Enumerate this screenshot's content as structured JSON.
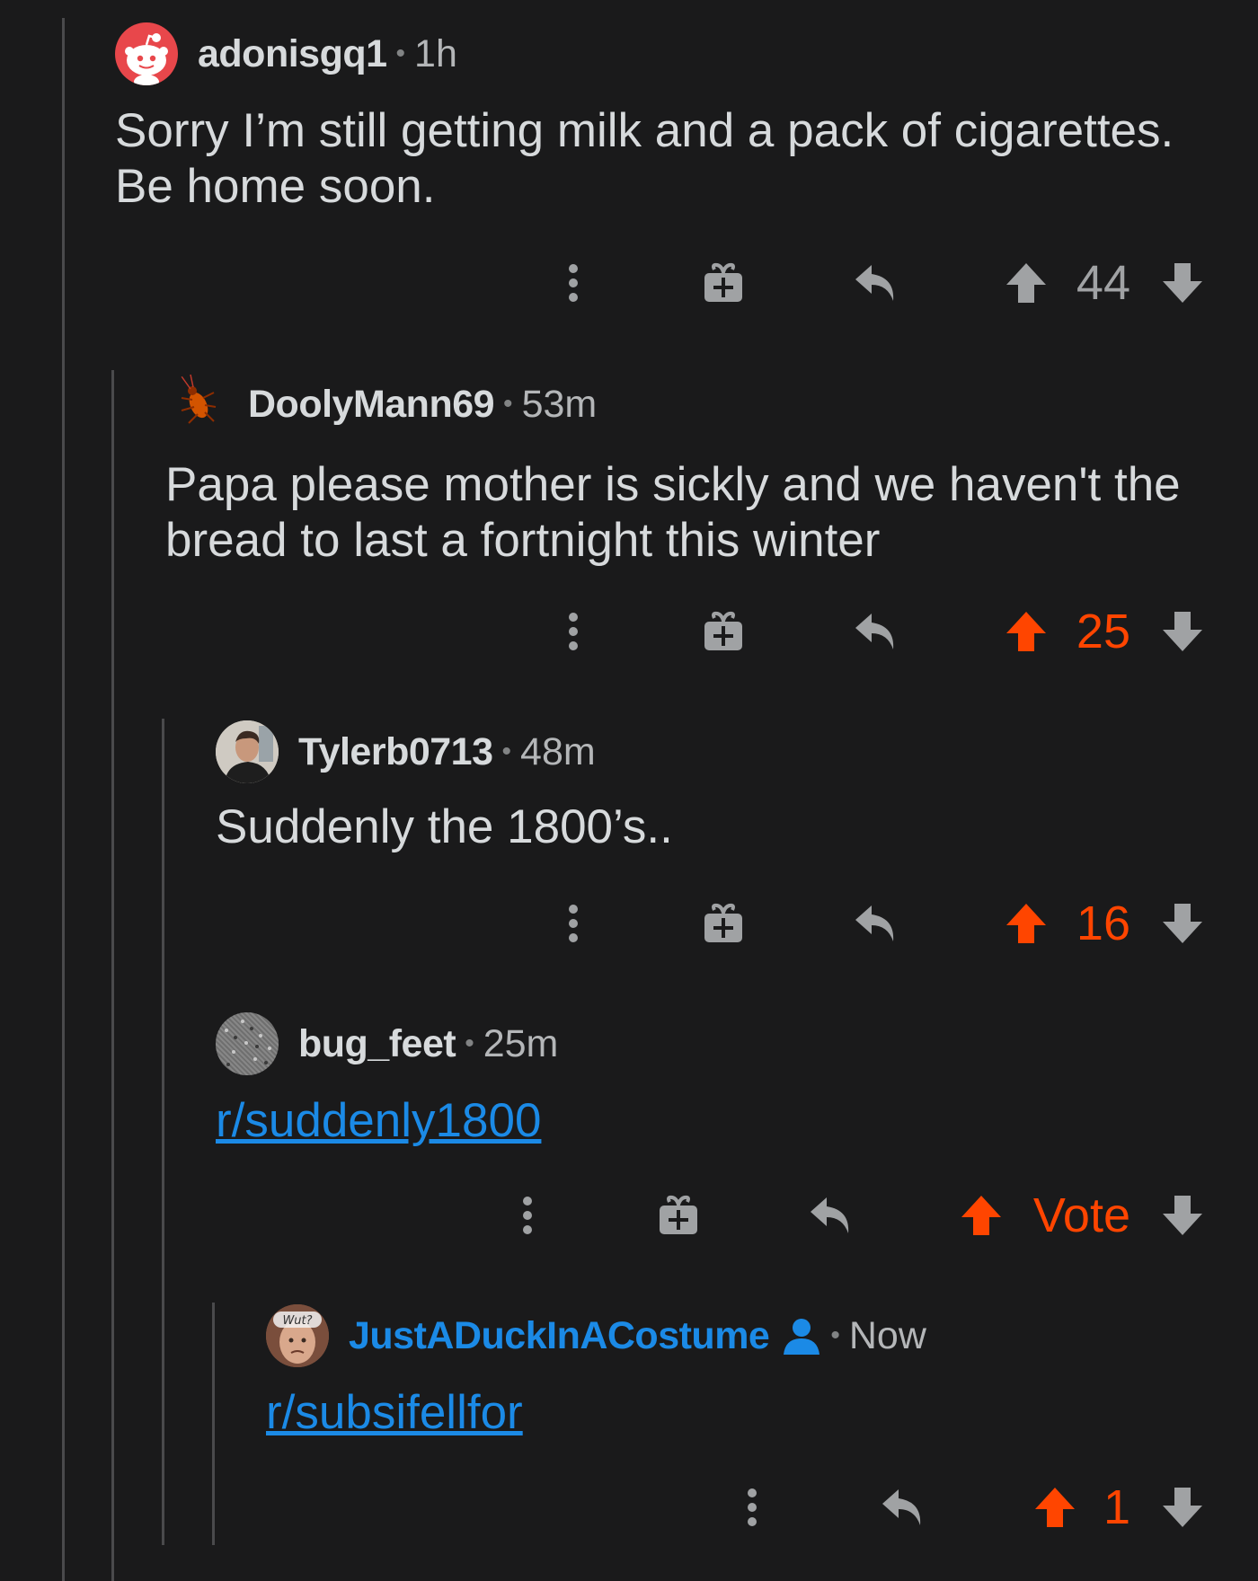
{
  "colors": {
    "background": "#1a1a1b",
    "text": "#d7dadc",
    "muted": "#818384",
    "upvote": "#ff4500",
    "link": "#1b8ae6"
  },
  "comments": [
    {
      "username": "adonisgq1",
      "time": "1h",
      "avatar_icon": "snoo-avatar-icon",
      "body": "Sorry I’m still getting milk and a pack of cigarettes. Be home soon.",
      "score": "44",
      "upvoted": false
    },
    {
      "username": "DoolyMann69",
      "time": "53m",
      "avatar_icon": "cockroach-avatar-icon",
      "body": "Papa please mother is sickly and we haven't the bread to last a fortnight this winter",
      "score": "25",
      "upvoted": true
    },
    {
      "username": "Tylerb0713",
      "time": "48m",
      "avatar_icon": "photo-avatar-icon",
      "body": "Suddenly the 1800’s..",
      "score": "16",
      "upvoted": true
    },
    {
      "username": "bug_feet",
      "time": "25m",
      "avatar_icon": "noise-avatar-icon",
      "link": "r/suddenly1800",
      "score": "Vote",
      "upvoted": true
    },
    {
      "username": "JustADuckInACostume",
      "time": "Now",
      "avatar_icon": "wut-avatar-icon",
      "badge_icon": "user-badge-icon",
      "link": "r/subsifellfor",
      "score": "1",
      "upvoted": true
    }
  ],
  "icons": {
    "more": "more-vertical-icon",
    "award": "gift-icon",
    "reply": "reply-icon",
    "upvote": "upvote-arrow-icon",
    "downvote": "downvote-arrow-icon"
  }
}
